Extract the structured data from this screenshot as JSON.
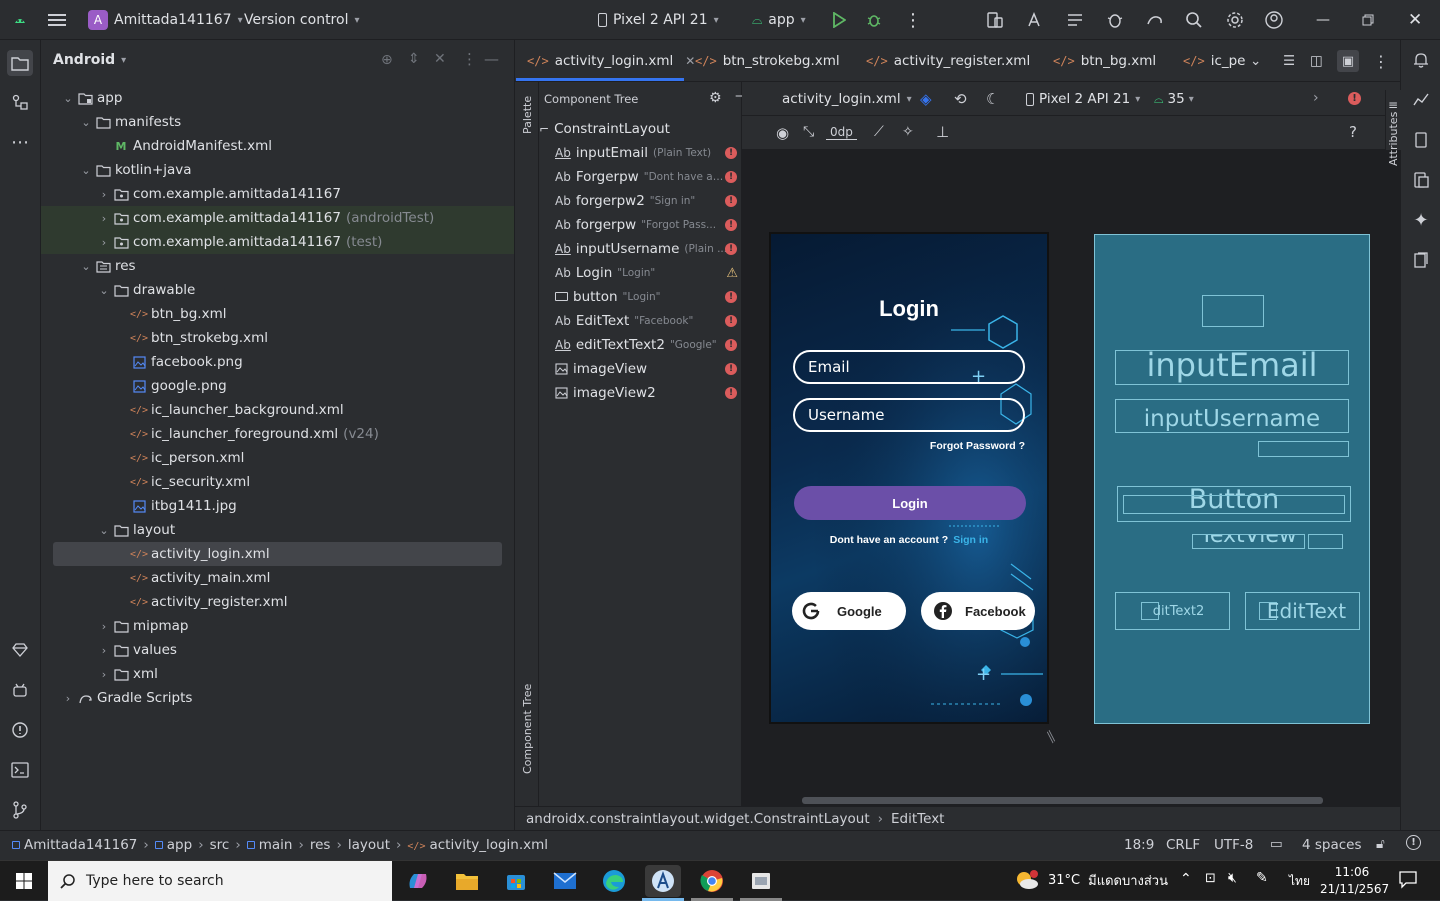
{
  "titlebar": {
    "project_badge": "A",
    "project_name": "Amittada141167",
    "vcs": "Version control",
    "device": "Pixel 2 API 21",
    "run_config": "app"
  },
  "sidebar_title": "Android",
  "tree": [
    {
      "label": "app",
      "suffix": "",
      "icon": "module-folder-icon"
    },
    {
      "label": "manifests",
      "suffix": "",
      "icon": "folder-icon"
    },
    {
      "label": "AndroidManifest.xml",
      "suffix": "",
      "icon": "manifest-icon"
    },
    {
      "label": "kotlin+java",
      "suffix": "",
      "icon": "folder-icon"
    },
    {
      "label": "com.example.amittada141167",
      "suffix": "",
      "icon": "package-icon"
    },
    {
      "label": "com.example.amittada141167",
      "suffix": "(androidTest)",
      "icon": "package-icon"
    },
    {
      "label": "com.example.amittada141167",
      "suffix": "(test)",
      "icon": "package-icon"
    },
    {
      "label": "res",
      "suffix": "",
      "icon": "res-folder-icon"
    },
    {
      "label": "drawable",
      "suffix": "",
      "icon": "folder-icon"
    },
    {
      "label": "btn_bg.xml",
      "suffix": "",
      "icon": "xml-icon"
    },
    {
      "label": "btn_strokebg.xml",
      "suffix": "",
      "icon": "xml-icon"
    },
    {
      "label": "facebook.png",
      "suffix": "",
      "icon": "image-icon"
    },
    {
      "label": "google.png",
      "suffix": "",
      "icon": "image-icon"
    },
    {
      "label": "ic_launcher_background.xml",
      "suffix": "",
      "icon": "xml-icon"
    },
    {
      "label": "ic_launcher_foreground.xml",
      "suffix": "(v24)",
      "icon": "xml-icon"
    },
    {
      "label": "ic_person.xml",
      "suffix": "",
      "icon": "xml-icon"
    },
    {
      "label": "ic_security.xml",
      "suffix": "",
      "icon": "xml-icon"
    },
    {
      "label": "itbg1411.jpg",
      "suffix": "",
      "icon": "image-icon"
    },
    {
      "label": "layout",
      "suffix": "",
      "icon": "folder-icon"
    },
    {
      "label": "activity_login.xml",
      "suffix": "",
      "icon": "xml-icon"
    },
    {
      "label": "activity_main.xml",
      "suffix": "",
      "icon": "xml-icon"
    },
    {
      "label": "activity_register.xml",
      "suffix": "",
      "icon": "xml-icon"
    },
    {
      "label": "mipmap",
      "suffix": "",
      "icon": "folder-icon"
    },
    {
      "label": "values",
      "suffix": "",
      "icon": "folder-icon"
    },
    {
      "label": "xml",
      "suffix": "",
      "icon": "folder-icon"
    },
    {
      "label": "Gradle Scripts",
      "suffix": "",
      "icon": "gradle-icon"
    }
  ],
  "tabs": [
    "activity_login.xml",
    "btn_strokebg.xml",
    "activity_register.xml",
    "btn_bg.xml",
    "ic_pe"
  ],
  "panel_labels": {
    "palette": "Palette",
    "component_tree_vertical": "Component Tree",
    "attributes": "Attributes"
  },
  "component_tree": {
    "title": "Component Tree",
    "root": "ConstraintLayout",
    "items": [
      {
        "type": "Ab",
        "name": "inputEmail",
        "hint": "(Plain Text)",
        "status": "error"
      },
      {
        "type": "Ab",
        "name": "Forgerpw",
        "hint": "\"Dont have an...",
        "status": "error"
      },
      {
        "type": "Ab",
        "name": "forgerpw2",
        "hint": "\"Sign in\"",
        "status": "error"
      },
      {
        "type": "Ab",
        "name": "forgerpw",
        "hint": "\"Forgot Pass...",
        "status": "error"
      },
      {
        "type": "Ab",
        "name": "inputUsername",
        "hint": "(Plain ...",
        "status": "error"
      },
      {
        "type": "Ab",
        "name": "Login",
        "hint": "\"Login\"",
        "status": "warning"
      },
      {
        "type": "btn",
        "name": "button",
        "hint": "\"Login\"",
        "status": "error"
      },
      {
        "type": "Ab",
        "name": "EditText",
        "hint": "\"Facebook\"",
        "status": "error"
      },
      {
        "type": "Ab",
        "name": "editTextText2",
        "hint": "\"Google\"",
        "status": "error"
      },
      {
        "type": "img",
        "name": "imageView",
        "hint": "",
        "status": "error"
      },
      {
        "type": "img",
        "name": "imageView2",
        "hint": "",
        "status": "error"
      }
    ]
  },
  "design_toolbar": {
    "file": "activity_login.xml",
    "device": "Pixel 2 API 21",
    "api": "35",
    "margin": "0dp"
  },
  "preview": {
    "title": "Login",
    "email_hint": "Email",
    "username_hint": "Username",
    "forgot": "Forgot Password ?",
    "login_btn": "Login",
    "no_account": "Dont have an account ?",
    "sign_in": "Sign in",
    "google": "Google",
    "facebook": "Facebook"
  },
  "blueprint": {
    "email": "inputEmail",
    "username": "inputUsername",
    "button": "Button",
    "textview": "TextView",
    "edit2": "ditText2",
    "edit": "EditText"
  },
  "status_path": {
    "class": "androidx.constraintlayout.widget.ConstraintLayout",
    "selected": "EditText"
  },
  "breadcrumb": [
    "Amittada141167",
    "app",
    "src",
    "main",
    "res",
    "layout",
    "activity_login.xml"
  ],
  "bottom_status": {
    "position": "18:9",
    "line_sep": "CRLF",
    "encoding": "UTF-8",
    "indent": "4 spaces"
  },
  "taskbar": {
    "search": "Type here to search",
    "weather": "31°C",
    "weather_desc": "มีแดดบางส่วน",
    "lang": "ไทย",
    "time": "11:06",
    "date": "21/11/2567"
  },
  "colors": {
    "accent": "#3574f0",
    "error": "#db5c5c",
    "warning": "#e5c07b",
    "login_button": "#6b4fa8",
    "blueprint": "#2a6d84"
  }
}
